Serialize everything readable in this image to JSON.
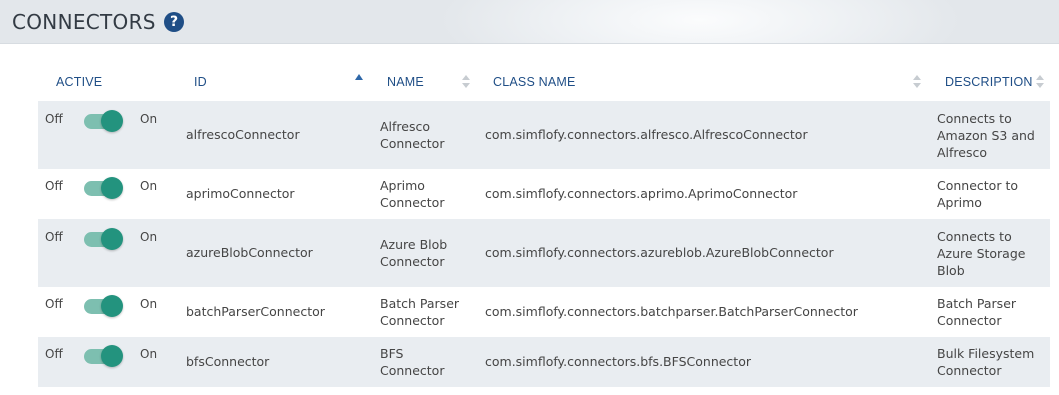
{
  "header": {
    "title": "CONNECTORS",
    "help_glyph": "?"
  },
  "columns": {
    "active": "ACTIVE",
    "id": "ID",
    "name": "NAME",
    "class_name": "CLASS NAME",
    "description": "DESCRIPTION"
  },
  "sort": {
    "column": "id",
    "direction": "ascending"
  },
  "toggle": {
    "off_label": "Off",
    "on_label": "On"
  },
  "rows": [
    {
      "active": true,
      "id": "alfrescoConnector",
      "name": [
        "Alfresco",
        "Connector"
      ],
      "class_name": "com.simflofy.connectors.alfresco.AlfrescoConnector",
      "description": [
        "Connects to",
        "Amazon S3 and",
        "Alfresco"
      ]
    },
    {
      "active": true,
      "id": "aprimoConnector",
      "name": [
        "Aprimo",
        "Connector"
      ],
      "class_name": "com.simflofy.connectors.aprimo.AprimoConnector",
      "description": [
        "Connector to",
        "Aprimo"
      ]
    },
    {
      "active": true,
      "id": "azureBlobConnector",
      "name": [
        "Azure Blob",
        "Connector"
      ],
      "class_name": "com.simflofy.connectors.azureblob.AzureBlobConnector",
      "description": [
        "Connects to",
        "Azure Storage",
        "Blob"
      ]
    },
    {
      "active": true,
      "id": "batchParserConnector",
      "name": [
        "Batch Parser",
        "Connector"
      ],
      "class_name": "com.simflofy.connectors.batchparser.BatchParserConnector",
      "description": [
        "Batch Parser",
        "Connector"
      ]
    },
    {
      "active": true,
      "id": "bfsConnector",
      "name": [
        "BFS",
        "Connector"
      ],
      "class_name": "com.simflofy.connectors.bfs.BFSConnector",
      "description": [
        "Bulk Filesystem",
        "Connector"
      ]
    }
  ],
  "colors": {
    "accent": "#1f4e86",
    "toggle_knob": "#23937e",
    "toggle_track": "#7dbfb0",
    "row_alt": "#e9edf1"
  }
}
